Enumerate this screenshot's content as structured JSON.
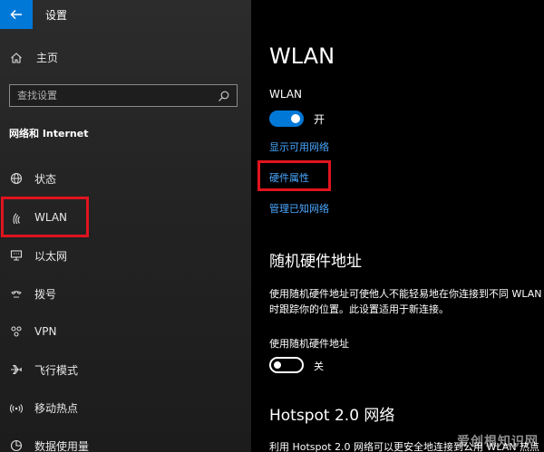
{
  "app": {
    "title": "设置"
  },
  "sidebar": {
    "home_label": "主页",
    "search_placeholder": "查找设置",
    "section_title": "网络和 Internet",
    "items": [
      {
        "label": "状态",
        "icon": "globe-icon"
      },
      {
        "label": "WLAN",
        "icon": "wifi-icon",
        "highlighted": true
      },
      {
        "label": "以太网",
        "icon": "ethernet-icon"
      },
      {
        "label": "拨号",
        "icon": "dialup-icon"
      },
      {
        "label": "VPN",
        "icon": "vpn-icon"
      },
      {
        "label": "飞行模式",
        "icon": "airplane-icon"
      },
      {
        "label": "移动热点",
        "icon": "hotspot-icon"
      },
      {
        "label": "数据使用量",
        "icon": "data-usage-icon"
      }
    ]
  },
  "main": {
    "title": "WLAN",
    "wlan_label": "WLAN",
    "wlan_toggle_state": "开",
    "links": {
      "show_networks": "显示可用网络",
      "hardware_properties": "硬件属性",
      "manage_known": "管理已知网络"
    },
    "random_hw": {
      "heading": "随机硬件地址",
      "description": "使用随机硬件地址可使他人不能轻易地在你连接到不同 WLAN 网络时跟踪你的位置。此设置适用于新连接。",
      "toggle_label": "使用随机硬件地址",
      "toggle_state": "关"
    },
    "hotspot": {
      "heading": "Hotspot 2.0 网络",
      "description": "利用 Hotspot 2.0 网络可以更安全地连接到公用 WLAN 热点"
    }
  },
  "watermark": "爱创根知识网",
  "colors": {
    "accent": "#0078d7",
    "link": "#4aa8ff",
    "highlight_box": "#e0141e"
  }
}
